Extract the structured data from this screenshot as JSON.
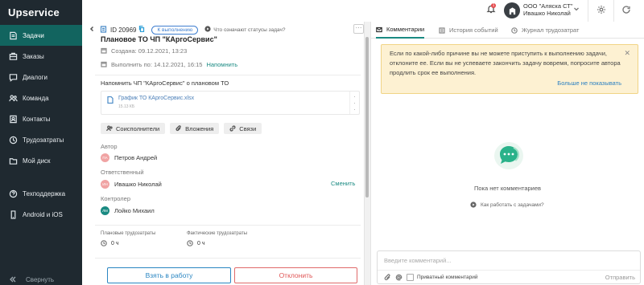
{
  "app": {
    "logo": "Upservice"
  },
  "sidebar": {
    "items": [
      {
        "label": "Задачи",
        "icon": "tasks-icon",
        "active": true
      },
      {
        "label": "Заказы",
        "icon": "orders-icon"
      },
      {
        "label": "Диалоги",
        "icon": "dialogs-icon"
      },
      {
        "label": "Команда",
        "icon": "team-icon"
      },
      {
        "label": "Контакты",
        "icon": "contacts-icon"
      },
      {
        "label": "Трудозатраты",
        "icon": "labor-icon"
      },
      {
        "label": "Мой диск",
        "icon": "folder-icon"
      }
    ],
    "bottom_items": [
      {
        "label": "Техподдержка",
        "icon": "support-icon"
      },
      {
        "label": "Android и iOS",
        "icon": "mobile-icon"
      }
    ],
    "collapse_label": "Свернуть"
  },
  "topbar": {
    "notification_count": "1",
    "company": "ООО \"Аляска СТ\"",
    "user": "Ивашко Николай"
  },
  "task": {
    "id_label": "ID 20969",
    "status": "К выполнению",
    "status_help": "Что означают статусы задач?",
    "title": "Плановое ТО ЧП \"КАргоСервис\"",
    "created": "Создана: 09.12.2021, 13:23",
    "due": "Выполнить по: 14.12.2021, 16:15",
    "remind_link": "Напомнить",
    "description": "Напомнить ЧП \"КАргоСервис\" о плановом ТО",
    "attachment": {
      "name": "График ТО КАргоСервис.xlsx",
      "size": "15.13 КБ"
    },
    "chips": [
      "Соисполнители",
      "Вложения",
      "Связи"
    ],
    "author_label": "Автор",
    "author": {
      "name": "Петров Андрей",
      "initials": "ПА",
      "color": "#f0a3a3"
    },
    "assignee_label": "Ответственный",
    "assignee": {
      "name": "Ивашко Николай",
      "initials": "ИН",
      "color": "#f0a3a3"
    },
    "change_link": "Сменить",
    "controller_label": "Контролер",
    "controller": {
      "name": "Лойко Михаил",
      "initials": "ЛМ",
      "color": "#1a8a82"
    },
    "planned_label": "Плановые трудозатраты",
    "planned_value": "0 ч",
    "actual_label": "Фактические трудозатраты",
    "actual_value": "0 ч",
    "take_button": "Взять в работу",
    "reject_button": "Отклонить"
  },
  "comments": {
    "tabs": [
      "Комментарии",
      "История событий",
      "Журнал трудозатрат"
    ],
    "alert_text": "Если по какой-либо причине вы не можете приступить к выполнению задачи, отклоните ее. Если вы не успеваете закончить задачу вовремя, попросите автора продлить срок ее выполнения.",
    "alert_hide": "Больше не показывать",
    "empty": "Пока нет комментариев",
    "howto": "Как работать с задачами?",
    "input_placeholder": "Введите комментарий...",
    "private_label": "Приватный комментарий",
    "send_label": "Отправить"
  },
  "colors": {
    "sidebar_bg": "#1f2930",
    "accent": "#12645f",
    "link": "#1a8a82",
    "primary": "#2a86c2",
    "danger": "#e05555",
    "alert_bg": "#fdf1d2"
  }
}
